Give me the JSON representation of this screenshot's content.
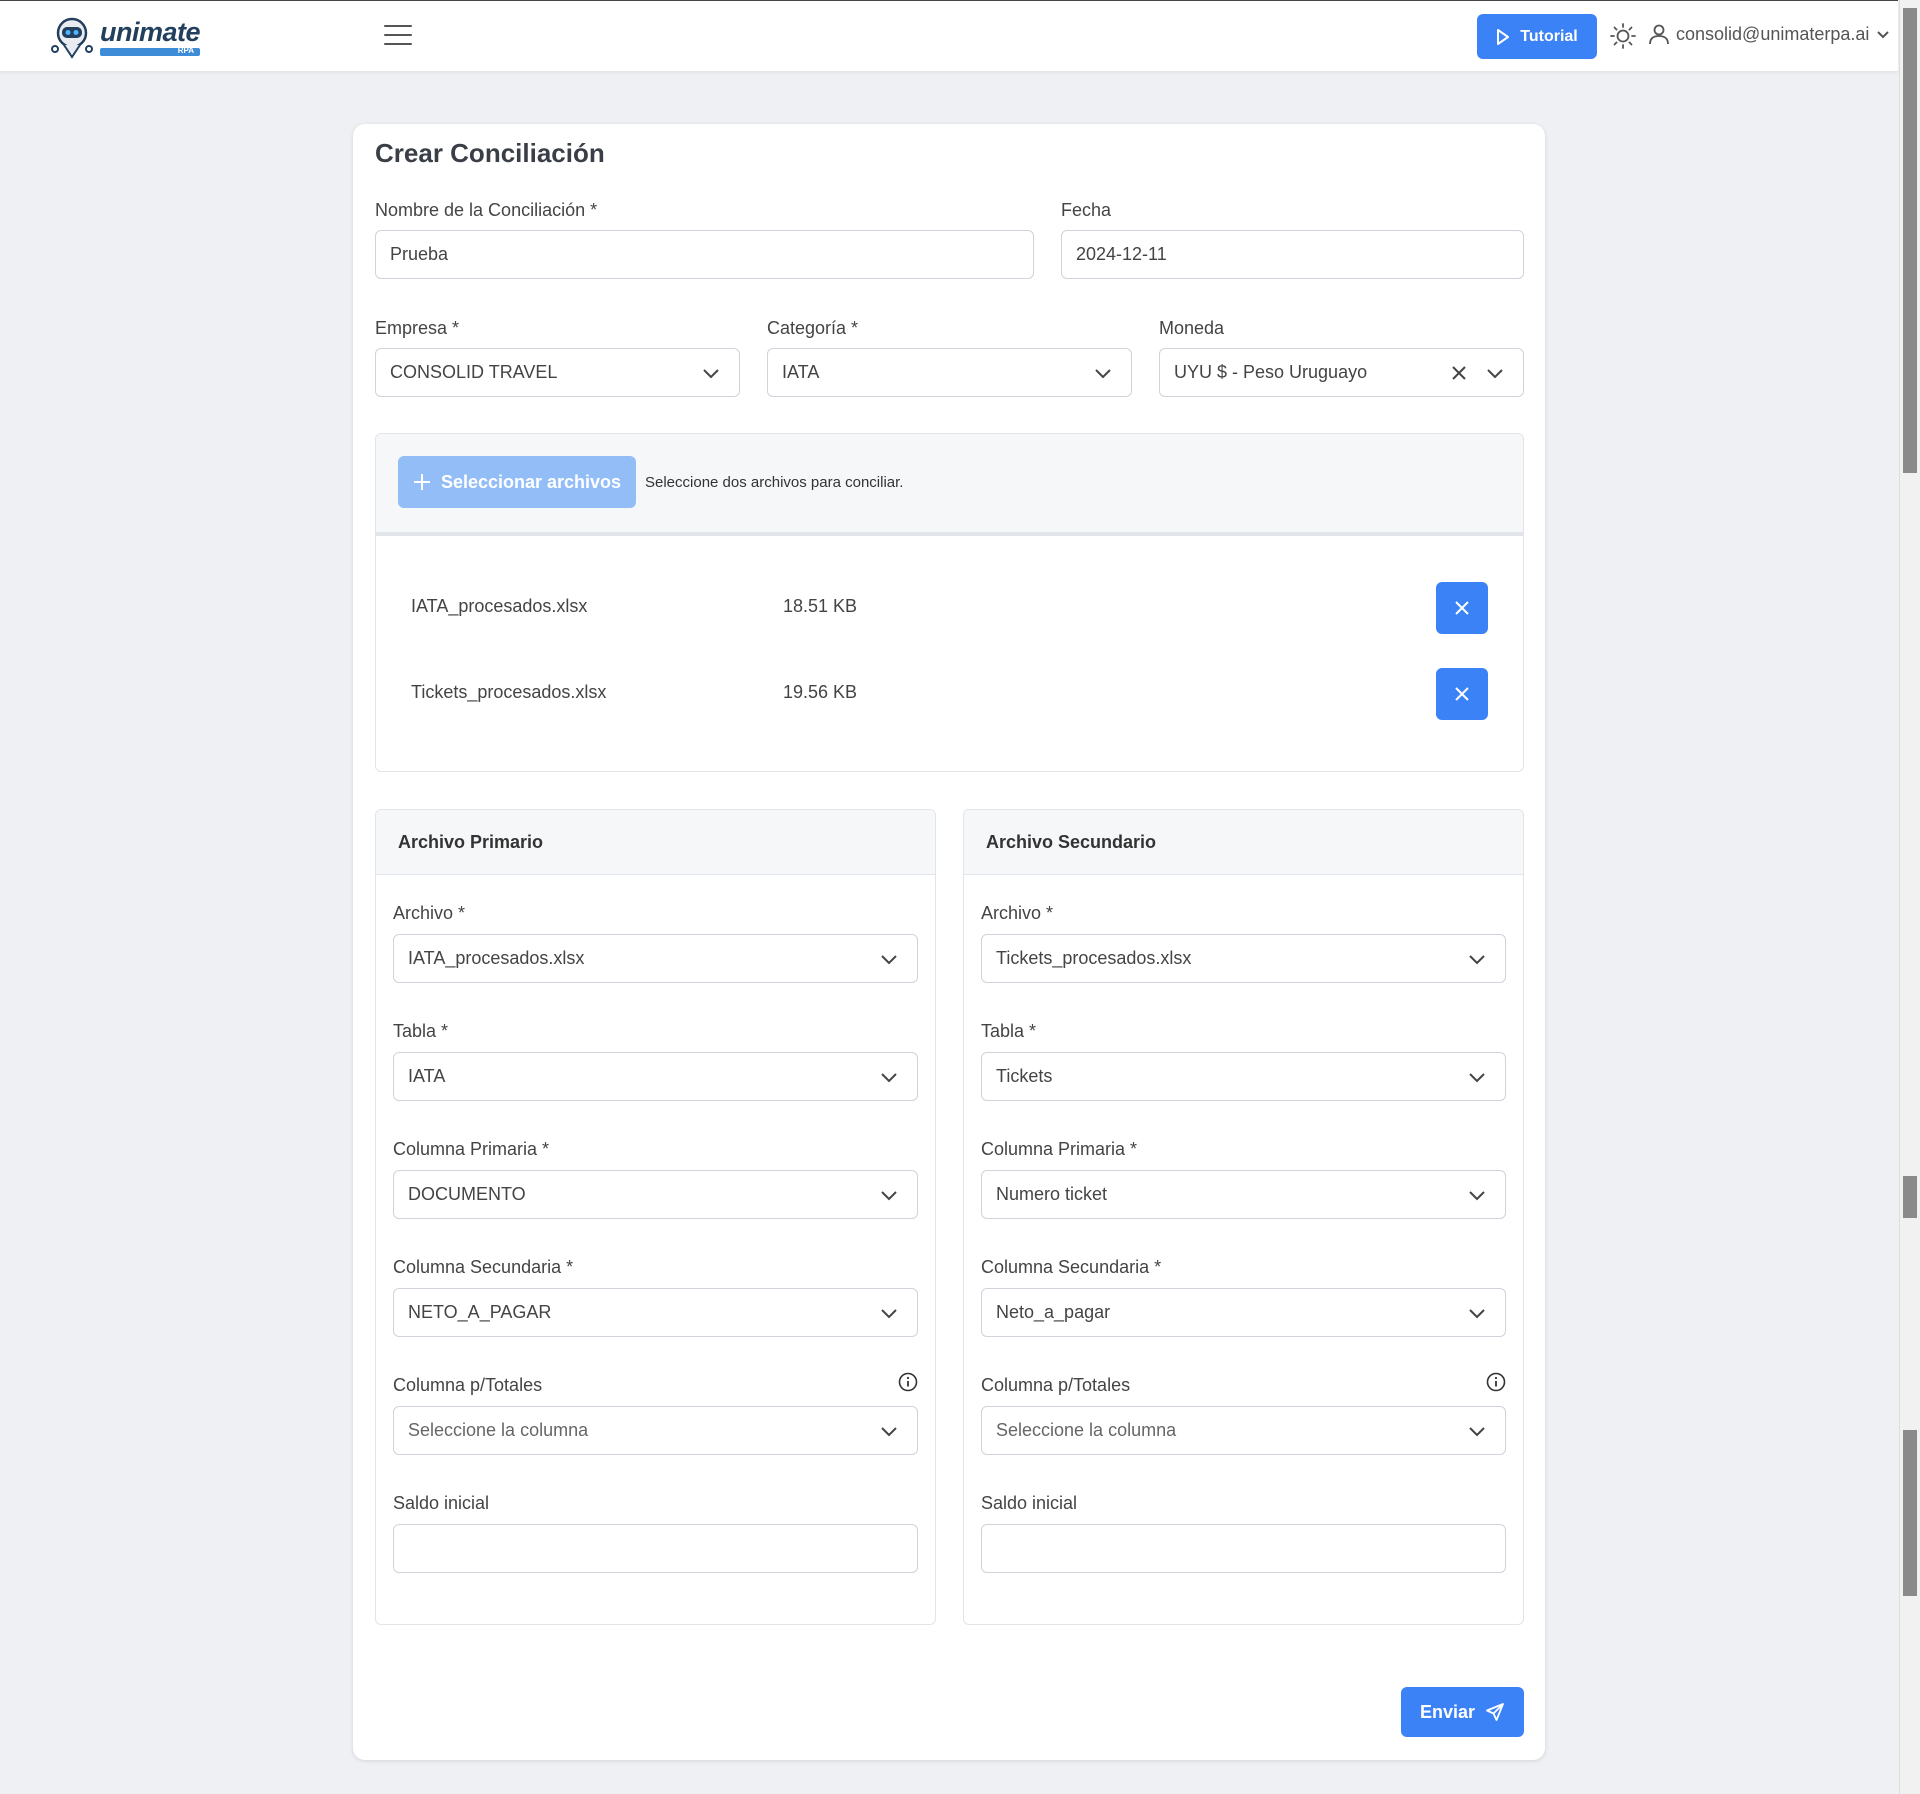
{
  "header": {
    "logo_text": "unimate",
    "logo_sub": "RPA",
    "tutorial_label": "Tutorial",
    "user_email": "consolid@unimaterpa.ai"
  },
  "form": {
    "title": "Crear Conciliación",
    "name_label": "Nombre de la Conciliación *",
    "name_value": "Prueba",
    "date_label": "Fecha",
    "date_value": "2024-12-11",
    "company_label": "Empresa *",
    "company_value": "CONSOLID TRAVEL",
    "category_label": "Categoría *",
    "category_value": "IATA",
    "currency_label": "Moneda",
    "currency_value": "UYU $ - Peso Uruguayo"
  },
  "upload": {
    "select_label": "Seleccionar archivos",
    "hint": "Seleccione dos archivos para conciliar.",
    "files": [
      {
        "name": "IATA_procesados.xlsx",
        "size": "18.51 KB"
      },
      {
        "name": "Tickets_procesados.xlsx",
        "size": "19.56 KB"
      }
    ]
  },
  "primary": {
    "title": "Archivo Primario",
    "file_label": "Archivo *",
    "file_value": "IATA_procesados.xlsx",
    "table_label": "Tabla *",
    "table_value": "IATA",
    "pcol_label": "Columna Primaria *",
    "pcol_value": "DOCUMENTO",
    "scol_label": "Columna Secundaria *",
    "scol_value": "NETO_A_PAGAR",
    "totals_label": "Columna p/Totales",
    "totals_placeholder": "Seleccione la columna",
    "balance_label": "Saldo inicial",
    "balance_value": ""
  },
  "secondary": {
    "title": "Archivo Secundario",
    "file_label": "Archivo *",
    "file_value": "Tickets_procesados.xlsx",
    "table_label": "Tabla *",
    "table_value": "Tickets",
    "pcol_label": "Columna Primaria *",
    "pcol_value": "Numero ticket",
    "scol_label": "Columna Secundaria *",
    "scol_value": "Neto_a_pagar",
    "totals_label": "Columna p/Totales",
    "totals_placeholder": "Seleccione la columna",
    "balance_label": "Saldo inicial",
    "balance_value": ""
  },
  "actions": {
    "send_label": "Enviar"
  },
  "colors": {
    "accent": "#3b82f6",
    "accent_disabled": "#93bdf7",
    "page_bg": "#eef0f4"
  }
}
